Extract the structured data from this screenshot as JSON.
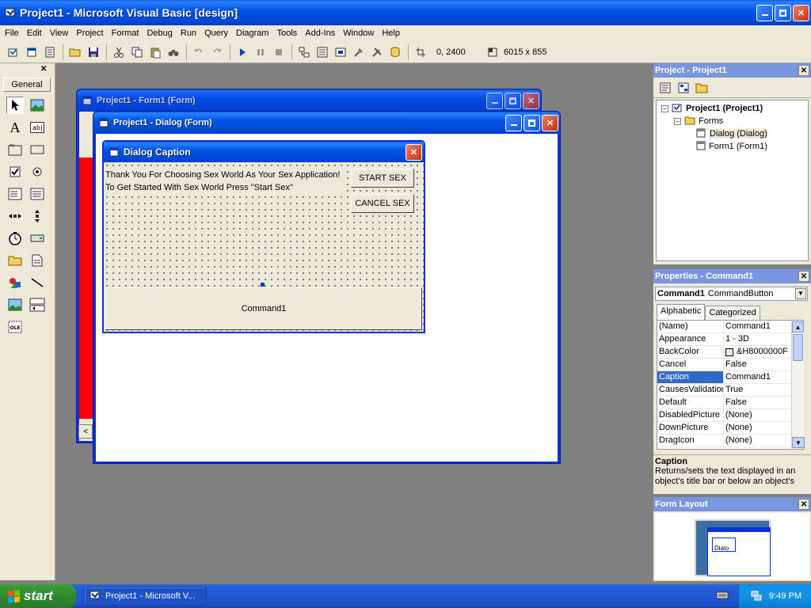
{
  "app": {
    "title": "Project1 - Microsoft Visual Basic [design]"
  },
  "menu": [
    "File",
    "Edit",
    "View",
    "Project",
    "Format",
    "Debug",
    "Run",
    "Query",
    "Diagram",
    "Tools",
    "Add-Ins",
    "Window",
    "Help"
  ],
  "toolbar": {
    "position": "0, 2400",
    "size": "6015 x 855"
  },
  "toolbox": {
    "tab": "General"
  },
  "windows": {
    "form1": {
      "title": "Project1 - Form1 (Form)"
    },
    "dialog_form": {
      "title": "Project1 - Dialog (Form)"
    },
    "dialog": {
      "caption": "Dialog Caption",
      "line1": "Thank You For Choosing Sex World As Your Sex Application!",
      "line2": "To Get Started With Sex World Press \"Start Sex\"",
      "start_button": "START SEX",
      "cancel_button": "CANCEL SEX",
      "command_button": "Command1"
    }
  },
  "project": {
    "title": "Project - Project1",
    "root": "Project1 (Project1)",
    "folder": "Forms",
    "items": [
      "Dialog (Dialog)",
      "Form1 (Form1)"
    ]
  },
  "properties": {
    "title": "Properties - Command1",
    "object": "Command1",
    "object_type": "CommandButton",
    "tabs": [
      "Alphabetic",
      "Categorized"
    ],
    "rows": [
      {
        "name": "(Name)",
        "value": "Command1"
      },
      {
        "name": "Appearance",
        "value": "1 - 3D"
      },
      {
        "name": "BackColor",
        "value": "&H8000000F"
      },
      {
        "name": "Cancel",
        "value": "False"
      },
      {
        "name": "Caption",
        "value": "Command1"
      },
      {
        "name": "CausesValidation",
        "value": "True"
      },
      {
        "name": "Default",
        "value": "False"
      },
      {
        "name": "DisabledPicture",
        "value": "(None)"
      },
      {
        "name": "DownPicture",
        "value": "(None)"
      },
      {
        "name": "DragIcon",
        "value": "(None)"
      }
    ],
    "selected_row": 4,
    "desc_title": "Caption",
    "desc_text": "Returns/sets the text displayed in an object's title bar or below an object's"
  },
  "layout": {
    "title": "Form Layout",
    "thumb_label": "Dialo"
  },
  "taskbar": {
    "start": "start",
    "task": "Project1 - Microsoft V...",
    "clock": "9:49 PM"
  }
}
